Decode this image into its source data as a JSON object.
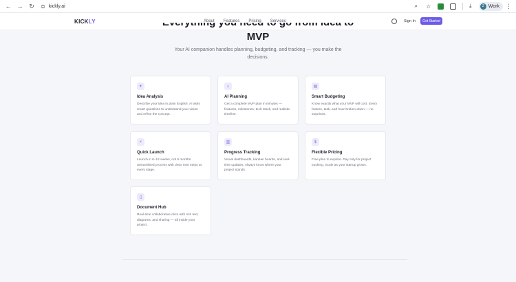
{
  "browser": {
    "url": "kickly.ai",
    "profile_initial": "Z",
    "profile_label": "Work",
    "icons": [
      "back-arrow-icon",
      "forward-arrow-icon",
      "reload-icon",
      "site-info-icon",
      "zoom-icon",
      "star-icon",
      "extension-icon",
      "extensions-puzzle-icon",
      "download-icon",
      "menu-kebab-icon"
    ]
  },
  "site": {
    "logo_main": "KICK",
    "logo_accent": "LY",
    "nav": [
      "About",
      "Features",
      "Pricing",
      "Services"
    ],
    "sign_in": "Sign In",
    "cta": "Get Started",
    "accent_color": "#6c5ce7"
  },
  "hero": {
    "title_line1": "Everything you need to go from idea to",
    "title_line2": "MVP",
    "subtitle": "Your AI companion handles planning, budgeting, and tracking — you make the decisions."
  },
  "features": [
    {
      "title": "Idea Analysis",
      "description": "Describe your idea in plain English. AI asks smart questions to understand your vision and refine the concept.",
      "icon": "lightbulb-icon"
    },
    {
      "title": "AI Planning",
      "description": "Get a complete MVP plan in minutes — features, milestones, tech stack, and realistic timeline.",
      "icon": "robot-icon"
    },
    {
      "title": "Smart Budgeting",
      "description": "Know exactly what your MVP will cost. Every feature, task, and hour broken down — no surprises.",
      "icon": "calculator-icon"
    },
    {
      "title": "Quick Launch",
      "description": "Launch in 6–12 weeks, not 6 months. Streamlined process with clear next steps at every stage.",
      "icon": "lightning-icon"
    },
    {
      "title": "Progress Tracking",
      "description": "Visual dashboards, kanban boards, and real-time updates. Always know where your project stands.",
      "icon": "chart-icon"
    },
    {
      "title": "Flexible Pricing",
      "description": "Free plan to explore. Pay only for project tracking. Scale as your startup grows.",
      "icon": "dollar-icon"
    },
    {
      "title": "Document Hub",
      "description": "Real-time collaborative docs with rich text, diagrams, and sharing — all inside your project.",
      "icon": "document-icon"
    }
  ]
}
